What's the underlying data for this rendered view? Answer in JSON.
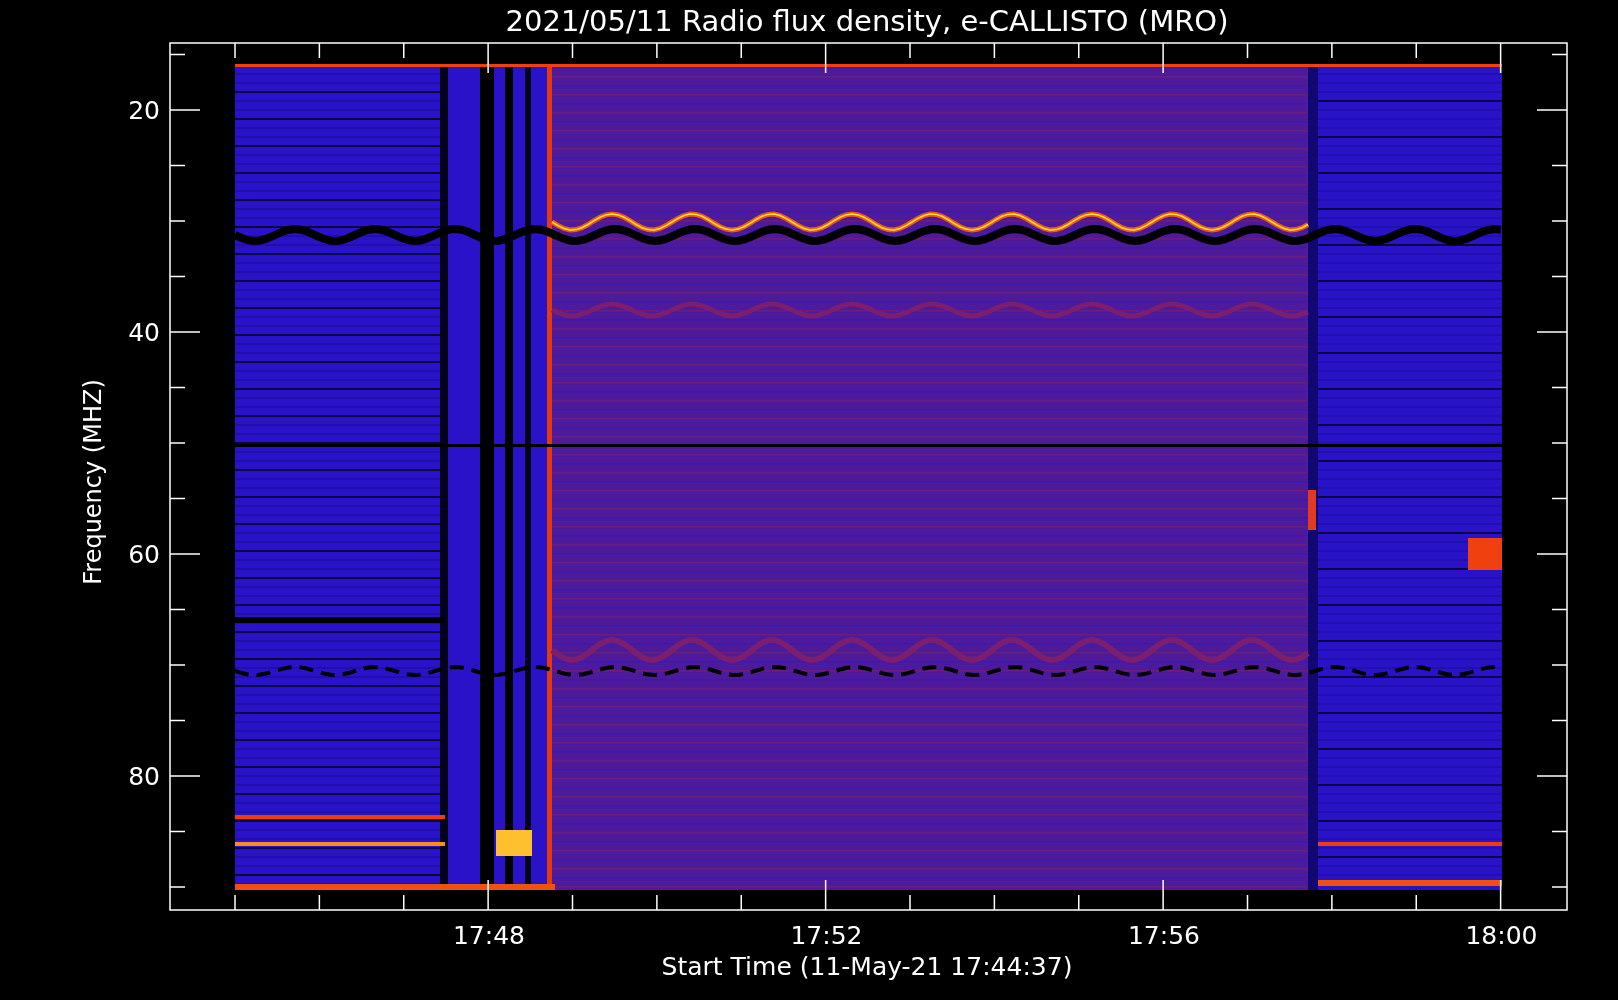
{
  "title": "2021/05/11  Radio flux density, e-CALLISTO (MRO)",
  "y_axis": {
    "label": "Frequency (MHZ)",
    "ticks": [
      "20",
      "40",
      "60",
      "80"
    ]
  },
  "x_axis": {
    "label": "Start Time (11-May-21 17:44:37)",
    "ticks": [
      "17:48",
      "17:52",
      "17:56",
      "18:00"
    ]
  }
}
